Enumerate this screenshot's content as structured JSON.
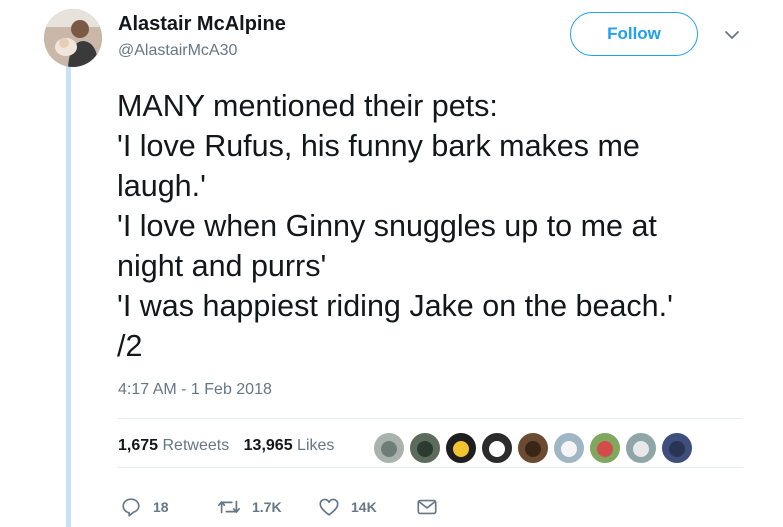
{
  "author": {
    "name": "Alastair McAlpine",
    "handle": "@AlastairMcA30"
  },
  "follow_label": "Follow",
  "tweet_lines": [
    "MANY mentioned their pets:",
    "'I love Rufus, his funny bark makes me",
    "laugh.'",
    "'I love when Ginny snuggles up to me at",
    "night and purrs'",
    "'I was happiest riding Jake on the beach.'",
    "/2"
  ],
  "timestamp": "4:17 AM - 1 Feb 2018",
  "stats": {
    "retweets_count": "1,675",
    "retweets_label": "Retweets",
    "likes_count": "13,965",
    "likes_label": "Likes"
  },
  "actions": {
    "replies": "18",
    "retweets": "1.7K",
    "likes": "14K"
  },
  "colors": {
    "accent": "#1da1f2",
    "secondary_text": "#657786",
    "thread_line": "#c4e3f7"
  },
  "liker_avatars": [
    {
      "icon": "owl-avatar",
      "bg": "#a9b2ad",
      "fg": "#6f7d78"
    },
    {
      "icon": "person-avatar",
      "bg": "#5b6b5c",
      "fg": "#2e3a30"
    },
    {
      "icon": "emoji-face-avatar",
      "bg": "#1e1e1e",
      "fg": "#f4c430"
    },
    {
      "icon": "swoosh-logo-avatar",
      "bg": "#2b2b2b",
      "fg": "#ffffff"
    },
    {
      "icon": "animal-avatar",
      "bg": "#6b4a32",
      "fg": "#3a2616"
    },
    {
      "icon": "yeti-avatar",
      "bg": "#9fb6c4",
      "fg": "#f4f4f4"
    },
    {
      "icon": "flowers-avatar",
      "bg": "#7fa85e",
      "fg": "#d44b4b"
    },
    {
      "icon": "bird-avatar",
      "bg": "#8ea6a8",
      "fg": "#e8e8e8"
    },
    {
      "icon": "landscape-avatar",
      "bg": "#3d4f7a",
      "fg": "#2a3553"
    }
  ]
}
